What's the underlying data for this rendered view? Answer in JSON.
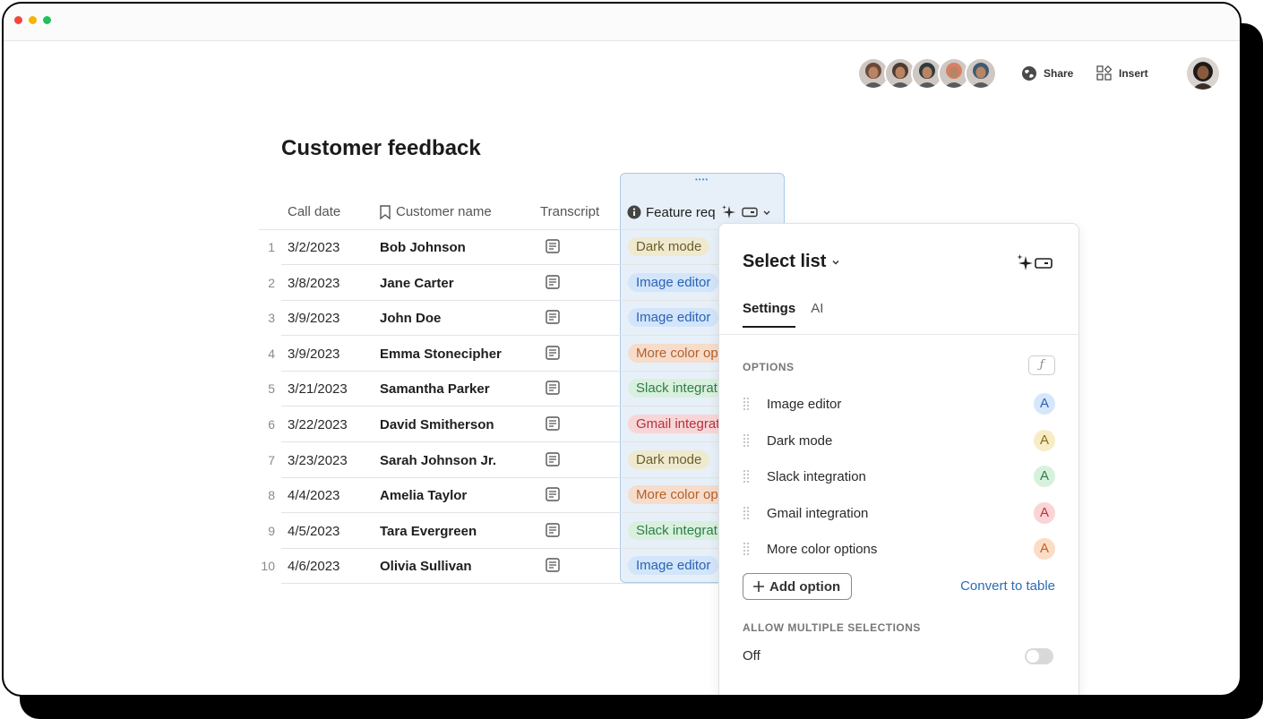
{
  "window": {
    "title_bar_controls": [
      "close",
      "minimize",
      "zoom"
    ]
  },
  "toolbar": {
    "collaborators": [
      {
        "name": "avatar-1",
        "color": "#6b4a3a"
      },
      {
        "name": "avatar-2",
        "color": "#4e3b33"
      },
      {
        "name": "avatar-3",
        "color": "#2f3a3c"
      },
      {
        "name": "avatar-4",
        "color": "#d97f66"
      },
      {
        "name": "avatar-5",
        "color": "#3f5a72"
      }
    ],
    "share_label": "Share",
    "insert_label": "Insert",
    "share_icon": "globe-icon",
    "insert_icon": "insert-shapes-icon"
  },
  "doc": {
    "title": "Customer feedback"
  },
  "table": {
    "columns": [
      {
        "label": "Call date",
        "icon": ""
      },
      {
        "label": "Customer name",
        "icon": "bookmark-icon"
      },
      {
        "label": "Transcript",
        "icon": ""
      },
      {
        "label": "Feature req",
        "icon": "info-icon"
      }
    ],
    "rows": [
      {
        "num": "1",
        "date": "3/2/2023",
        "name": "Bob Johnson",
        "feature": "Dark mode",
        "tone": "yellow"
      },
      {
        "num": "2",
        "date": "3/8/2023",
        "name": "Jane Carter",
        "feature": "Image editor",
        "tone": "blue"
      },
      {
        "num": "3",
        "date": "3/9/2023",
        "name": "John Doe",
        "feature": "Image editor",
        "tone": "blue"
      },
      {
        "num": "4",
        "date": "3/9/2023",
        "name": "Emma Stonecipher",
        "feature": "More color op",
        "tone": "orange"
      },
      {
        "num": "5",
        "date": "3/21/2023",
        "name": "Samantha Parker",
        "feature": "Slack integrat",
        "tone": "green"
      },
      {
        "num": "6",
        "date": "3/22/2023",
        "name": "David Smitherson",
        "feature": "Gmail integrat",
        "tone": "red"
      },
      {
        "num": "7",
        "date": "3/23/2023",
        "name": "Sarah Johnson Jr.",
        "feature": "Dark mode",
        "tone": "yellow"
      },
      {
        "num": "8",
        "date": "4/4/2023",
        "name": "Amelia Taylor",
        "feature": "More color op",
        "tone": "orange"
      },
      {
        "num": "9",
        "date": "4/5/2023",
        "name": "Tara Evergreen",
        "feature": "Slack integrat",
        "tone": "green"
      },
      {
        "num": "10",
        "date": "4/6/2023",
        "name": "Olivia Sullivan",
        "feature": "Image editor",
        "tone": "blue"
      }
    ]
  },
  "tones": {
    "yellow": {
      "bg": "#efe9cf",
      "fg": "#6b5e2a"
    },
    "blue": {
      "bg": "#d3e5fb",
      "fg": "#2a63b3"
    },
    "orange": {
      "bg": "#f6dccb",
      "fg": "#b5602a"
    },
    "green": {
      "bg": "#d9f0de",
      "fg": "#2f7d48"
    },
    "red": {
      "bg": "#f8d6d8",
      "fg": "#b3323d"
    }
  },
  "panel": {
    "title": "Select list",
    "tabs": [
      "Settings",
      "AI"
    ],
    "active_tab": "Settings",
    "options_label": "OPTIONS",
    "formula_icon": "ƒ",
    "options": [
      {
        "label": "Image editor",
        "badge": "A",
        "bg": "#d6e6fb",
        "fg": "#2a63b3"
      },
      {
        "label": "Dark mode",
        "badge": "A",
        "bg": "#f8ecc6",
        "fg": "#8a6a12"
      },
      {
        "label": "Slack integration",
        "badge": "A",
        "bg": "#d7f2dc",
        "fg": "#2f7d48"
      },
      {
        "label": "Gmail integration",
        "badge": "A",
        "bg": "#fad4d6",
        "fg": "#c0303c"
      },
      {
        "label": "More color options",
        "badge": "A",
        "bg": "#fbdcc6",
        "fg": "#c4601e"
      }
    ],
    "add_option_label": "Add option",
    "convert_label": "Convert to table",
    "multi_label": "ALLOW MULTIPLE SELECTIONS",
    "multi_value": "Off"
  }
}
